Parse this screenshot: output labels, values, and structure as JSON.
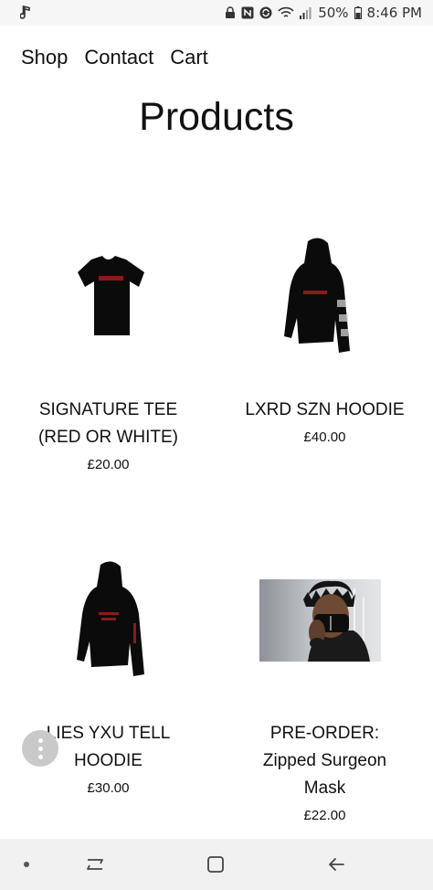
{
  "status_bar": {
    "battery_percent": "50%",
    "time": "8:46 PM"
  },
  "nav": {
    "items": [
      {
        "label": "Shop"
      },
      {
        "label": "Contact"
      },
      {
        "label": "Cart"
      }
    ]
  },
  "page": {
    "title": "Products"
  },
  "products": [
    {
      "name_line1": "SIGNATURE TEE",
      "name_line2": "(RED OR WHITE)",
      "price": "£20.00"
    },
    {
      "name_line1": "LXRD SZN HOODIE",
      "price": "£40.00"
    },
    {
      "name_line1": "LIES YXU TELL",
      "name_line2": "HOODIE",
      "price": "£30.00"
    },
    {
      "name_line1": "PRE-ORDER:",
      "name_line2": "Zipped Surgeon",
      "name_line3": "Mask",
      "price": "£22.00"
    }
  ],
  "colors": {
    "status_bar_bg": "#f6f6f6",
    "nav_bar_bg": "#f1f1f1",
    "garment": "#0b0b0b",
    "print_red": "#8b1a1a",
    "fab_bg": "#c9c9c9"
  },
  "icons": {
    "status_left": [
      "music-note-icon"
    ],
    "status_right": [
      "lock-icon",
      "nfc-icon",
      "sync-icon",
      "wifi-icon",
      "signal-icon",
      "battery-icon"
    ],
    "fab": "more-vertical-icon",
    "system_nav": [
      "dot-icon",
      "recent-apps-icon",
      "home-icon",
      "back-icon"
    ]
  }
}
